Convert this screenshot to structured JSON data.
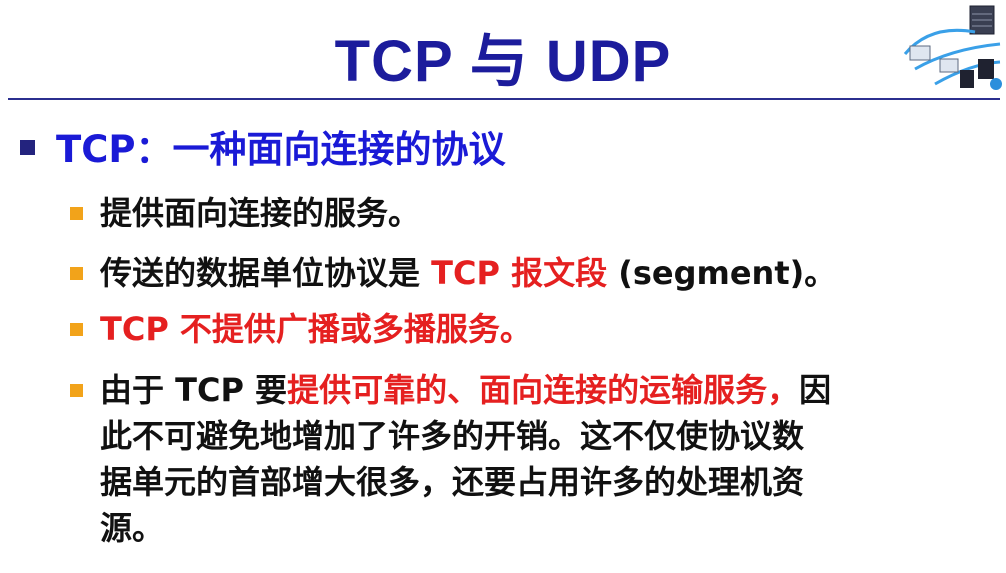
{
  "slide": {
    "title": "TCP 与 UDP",
    "heading": "TCP：一种面向连接的协议",
    "items": [
      {
        "text": "提供面向连接的服务。"
      },
      {
        "prefix": "传送的数据单位协议是 ",
        "highlight": "TCP 报文段",
        "suffix": " (segment)。"
      },
      {
        "highlight": "TCP 不提供广播或多播服务。"
      },
      {
        "prefix": "由于 TCP 要",
        "highlight": "提供可靠的、面向连接的运输服务，",
        "suffix": "因",
        "line2": "此不可避免地增加了许多的开销。这不仅使协议数",
        "line3": "据单元的首部增大很多，还要占用许多的处理机资",
        "line4": "源。"
      }
    ]
  },
  "colors": {
    "title": "#1c1c9c",
    "heading": "#1a1ad6",
    "highlight": "#e52020",
    "bullet1": "#23237e",
    "bullet2": "#f2a31a"
  },
  "icons": {
    "logo": "network-diagram-icon"
  }
}
